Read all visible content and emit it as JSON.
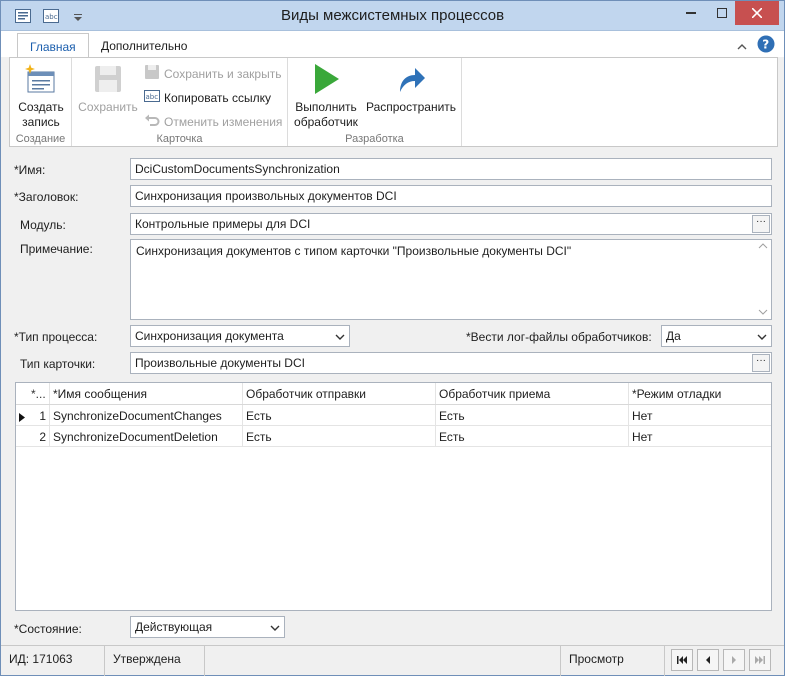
{
  "window": {
    "title": "Виды межсистемных процессов"
  },
  "ribbon": {
    "tabs": [
      {
        "label": "Главная",
        "active": true
      },
      {
        "label": "Дополнительно",
        "active": false
      }
    ],
    "groups": {
      "create": {
        "label": "Создание",
        "create_record": "Создать запись"
      },
      "card": {
        "label": "Карточка",
        "save": "Сохранить",
        "save_close": "Сохранить и закрыть",
        "copy_link": "Копировать ссылку",
        "undo_changes": "Отменить изменения"
      },
      "dev": {
        "label": "Разработка",
        "run_handler": "Выполнить обработчик",
        "distribute": "Распространить"
      }
    }
  },
  "form": {
    "name": {
      "label": "*Имя:",
      "value": "DciCustomDocumentsSynchronization"
    },
    "caption": {
      "label": "*Заголовок:",
      "value": "Синхронизация произвольных документов DCI"
    },
    "module": {
      "label": "Модуль:",
      "value": "Контрольные примеры для DCI"
    },
    "note": {
      "label": "Примечание:",
      "value": "Синхронизация документов с типом карточки \"Произвольные документы DCI\""
    },
    "process_type": {
      "label": "*Тип процесса:",
      "value": "Синхронизация документа"
    },
    "log_files": {
      "label": "*Вести лог-файлы обработчиков:",
      "value": "Да"
    },
    "card_type": {
      "label": "Тип карточки:",
      "value": "Произвольные документы DCI"
    },
    "state": {
      "label": "*Состояние:",
      "value": "Действующая"
    }
  },
  "grid": {
    "columns": [
      "*...",
      "*Имя сообщения",
      "Обработчик отправки",
      "Обработчик приема",
      "*Режим отладки"
    ],
    "rows": [
      {
        "num": "1",
        "message": "SynchronizeDocumentChanges",
        "send": "Есть",
        "receive": "Есть",
        "debug": "Нет"
      },
      {
        "num": "2",
        "message": "SynchronizeDocumentDeletion",
        "send": "Есть",
        "receive": "Есть",
        "debug": "Нет"
      }
    ]
  },
  "status": {
    "id": "ИД: 171063",
    "state": "Утверждена",
    "mode": "Просмотр"
  },
  "colors": {
    "accent": "#1c5fae",
    "run_green": "#3aa83a",
    "close_red": "#c75050"
  }
}
